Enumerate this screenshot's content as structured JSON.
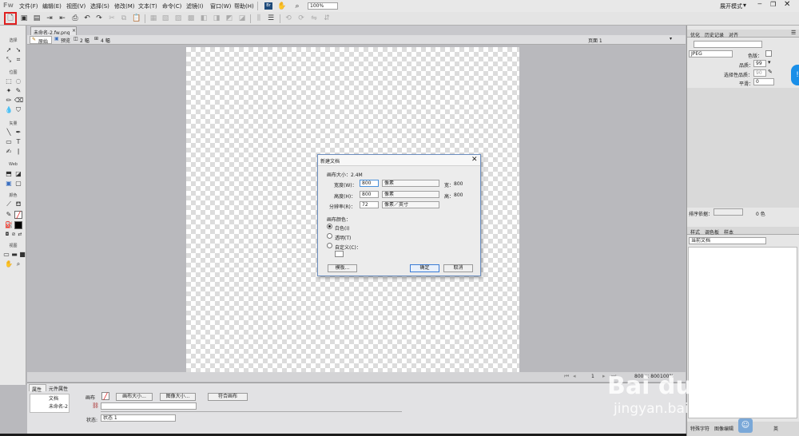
{
  "app": {
    "logo": "Fw"
  },
  "menu": [
    "文件(F)",
    "编辑(E)",
    "视图(V)",
    "选择(S)",
    "修改(M)",
    "文本(T)",
    "命令(C)",
    "滤镜(I)",
    "窗口(W)",
    "帮助(H)"
  ],
  "topbar": {
    "bridge_label": "Br",
    "zoom": "100%",
    "workspace": "展开模式"
  },
  "toolbox": {
    "sections": [
      "选择",
      "位图",
      "矢量",
      "Web",
      "颜色",
      "视图"
    ]
  },
  "document": {
    "tab": "未命名-2.fw.png",
    "views": [
      "原始",
      "预览",
      "2 幅",
      "4 幅"
    ],
    "page": "页面 1"
  },
  "status": {
    "page": "1",
    "size": "800 × 800",
    "zoom": "100%"
  },
  "properties": {
    "tabs": [
      "属性",
      "元件属性"
    ],
    "doc_label": "文档",
    "doc_name": "未命名-2",
    "canvas_label": "画布",
    "canvas_size_btn": "画布大小...",
    "image_size_btn": "图像大小...",
    "fit_canvas_btn": "符合画布",
    "state_label": "状态:",
    "state_value": "状态 1"
  },
  "dialog": {
    "title": "新建文档",
    "canvas_size": "画布大小：2.4M",
    "width_label": "宽度(W)：",
    "width_value": "800",
    "width_unit": "像素",
    "width_right_label": "宽：",
    "width_right_value": "800",
    "height_label": "高度(H)：",
    "height_value": "800",
    "height_unit": "像素",
    "height_right_label": "高：",
    "height_right_value": "800",
    "res_label": "分辨率(R)：",
    "res_value": "72",
    "res_unit": "像素／英寸",
    "color_label": "画布颜色：",
    "opt_white": "白色(I)",
    "opt_transparent": "透明(T)",
    "opt_custom": "自定义(C)：",
    "template_btn": "模板...",
    "ok_btn": "确定",
    "cancel_btn": "取消"
  },
  "right_panel": {
    "tabs": [
      "优化",
      "历史记录",
      "对齐"
    ],
    "format": "JPEG",
    "matte_label": "色版：",
    "quality_label": "品质：",
    "quality_value": "99",
    "sel_quality_label": "选择性品质：",
    "sel_quality_value": "90",
    "smooth_label": "平滑：",
    "smooth_value": "0",
    "sort_label": "排序依据：",
    "colors_value": "0 色",
    "lower_tabs": [
      "样式",
      "调色板",
      "样本"
    ],
    "style_select": "当前文档",
    "bottom_tabs": [
      "特殊字符",
      "图像编辑"
    ],
    "ime_label": "英"
  },
  "watermark": {
    "brand": "Bai du 经验",
    "url": "jingyan.baidu.com"
  }
}
